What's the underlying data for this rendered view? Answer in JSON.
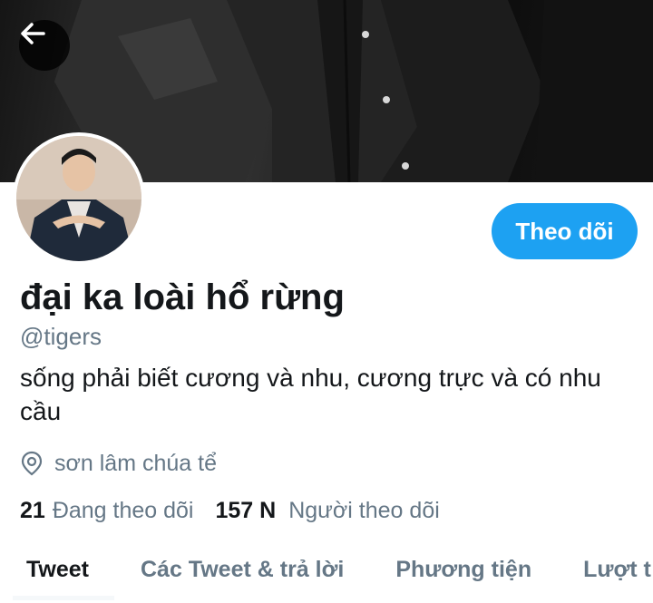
{
  "header": {
    "back_icon": "arrow-left-icon",
    "banner_description_color": "#1a1a1a"
  },
  "profile": {
    "display_name": "đại ka loài hổ rừng",
    "handle": "@tigers",
    "bio": "sống phải biết cương và nhu, cương trực và có nhu cầu",
    "location_icon": "location-pin-icon",
    "location": "sơn lâm chúa tể",
    "follow_label": "Theo dõi"
  },
  "stats": {
    "following_count": "21",
    "following_label": "Đang theo dõi",
    "followers_count": "157 N",
    "followers_label": "Người theo dõi"
  },
  "tabs": [
    {
      "label": "Tweet",
      "active": true
    },
    {
      "label": "Các Tweet & trả lời",
      "active": false
    },
    {
      "label": "Phương tiện",
      "active": false
    },
    {
      "label": "Lượt t",
      "active": false
    }
  ],
  "colors": {
    "accent": "#1da1f2",
    "text_primary": "#14171a",
    "text_secondary": "#657786"
  }
}
